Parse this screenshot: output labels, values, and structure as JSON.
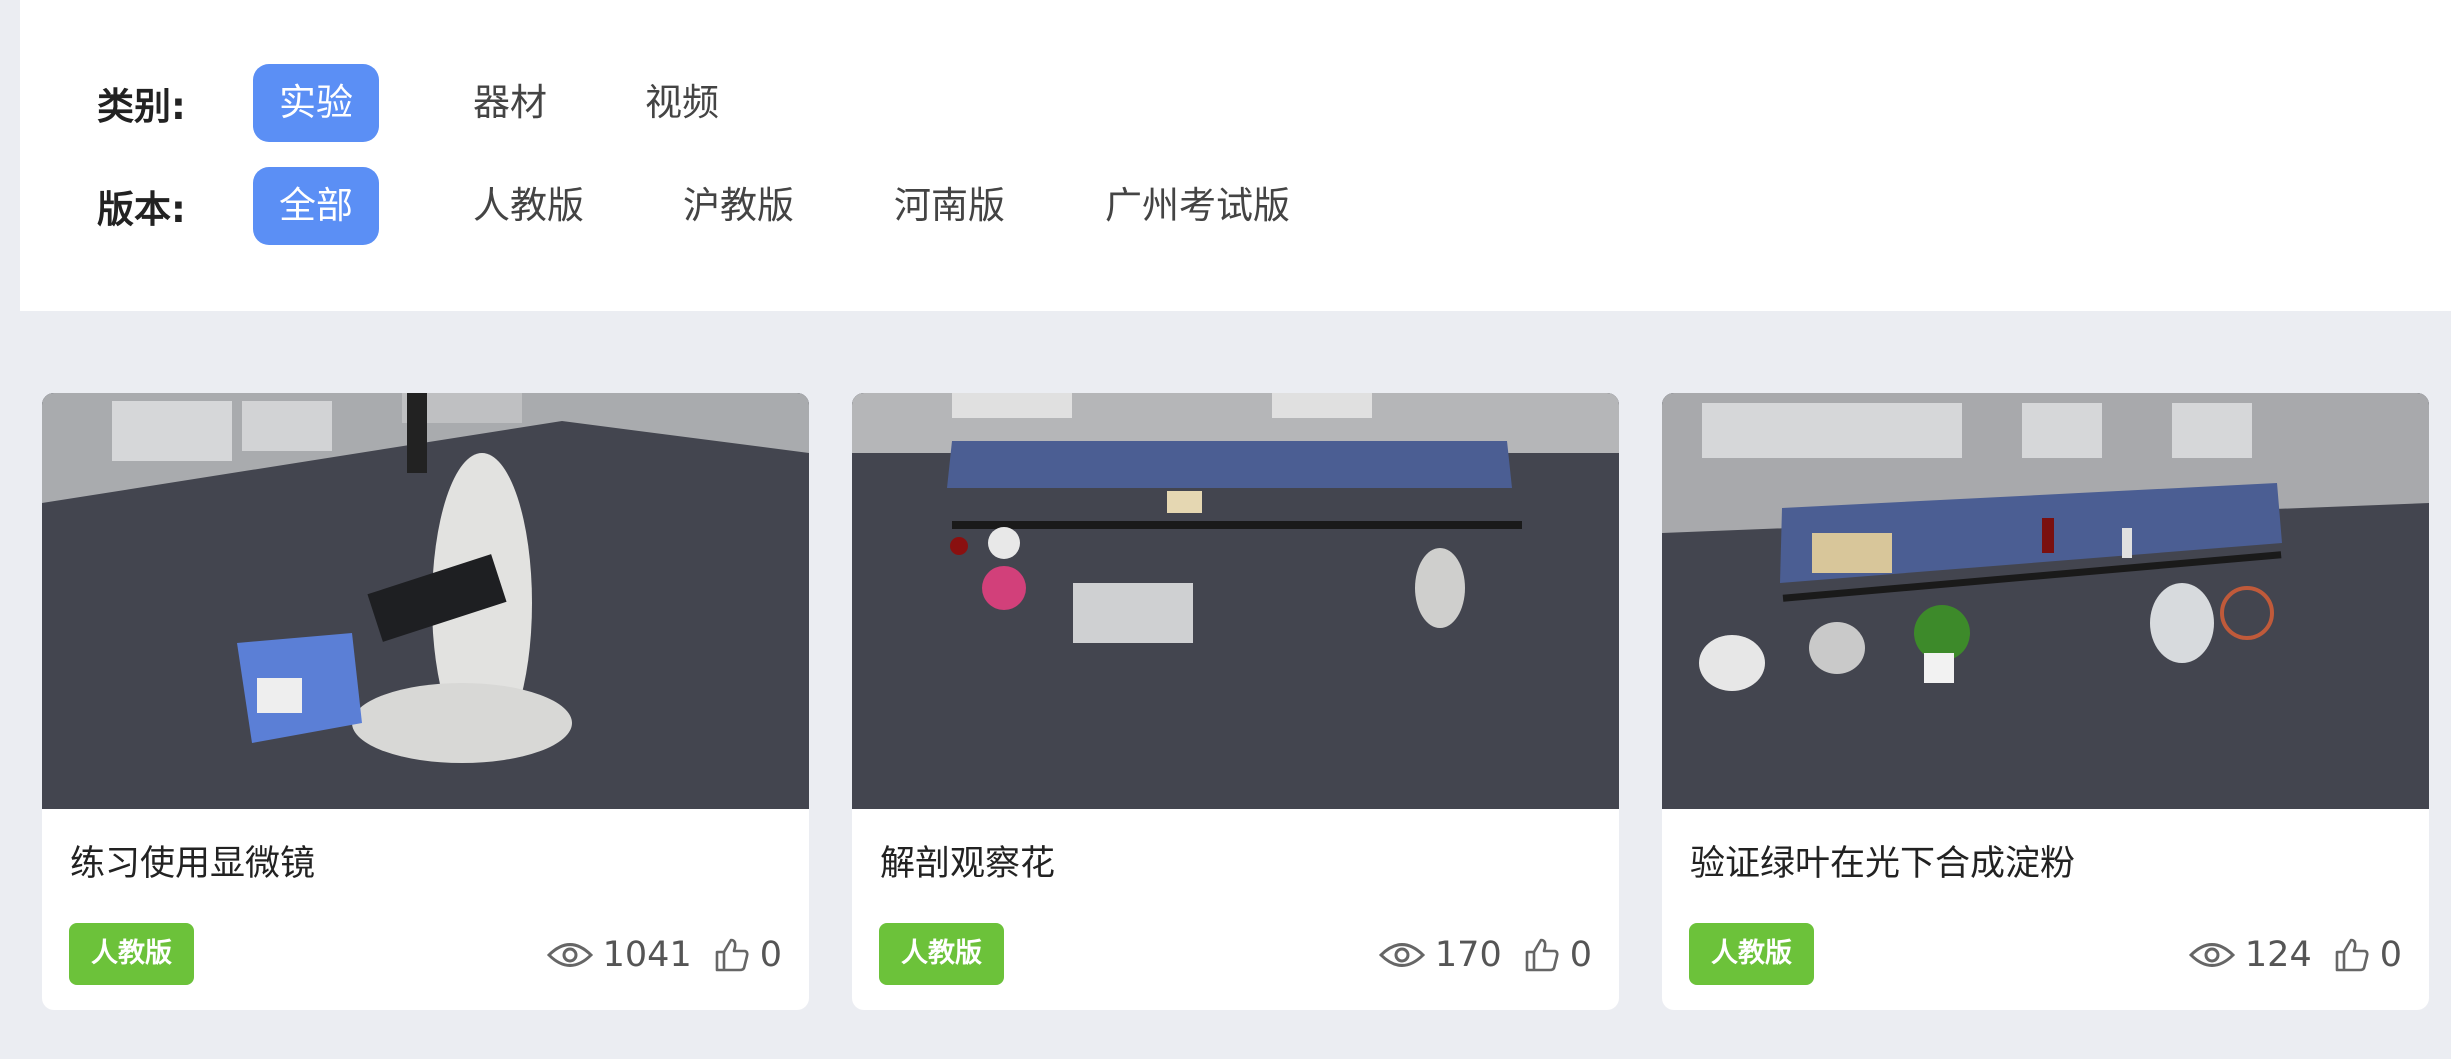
{
  "filters": {
    "category": {
      "label": "类别:",
      "options": [
        "实验",
        "器材",
        "视频"
      ],
      "selected": "实验"
    },
    "version": {
      "label": "版本:",
      "options": [
        "全部",
        "人教版",
        "沪教版",
        "河南版",
        "广州考试版"
      ],
      "selected": "全部"
    }
  },
  "colors": {
    "accent": "#5b8ff5",
    "tag": "#6cc23a",
    "background": "#ebedf2"
  },
  "cards": [
    {
      "title": "练习使用显微镜",
      "tag": "人教版",
      "views": "1041",
      "likes": "0"
    },
    {
      "title": "解剖观察花",
      "tag": "人教版",
      "views": "170",
      "likes": "0"
    },
    {
      "title": "验证绿叶在光下合成淀粉",
      "tag": "人教版",
      "views": "124",
      "likes": "0"
    }
  ]
}
